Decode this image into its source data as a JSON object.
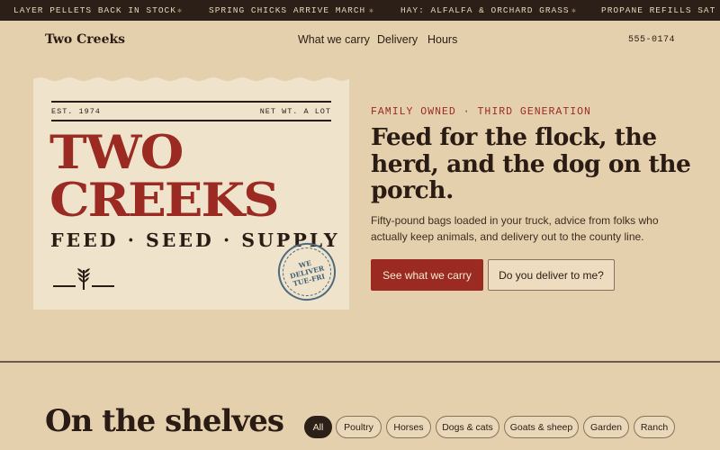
{
  "ticker": {
    "items": [
      "LAYER PELLETS BACK IN STOCK",
      "SPRING CHICKS ARRIVE MARCH",
      "HAY: ALFALFA & ORCHARD GRASS",
      "PROPANE REFILLS SAT MORN"
    ],
    "separator": "✱"
  },
  "nav": {
    "brand": "Two Creeks",
    "links": [
      "What we carry",
      "Delivery",
      "Hours"
    ],
    "phone": "555-0174"
  },
  "hero_card": {
    "established": "EST. 1974",
    "net_weight": "NET WT. A LOT",
    "word1": "TWO",
    "word2": "CREEKS",
    "subline": "FEED · SEED · SUPPLY",
    "stamp": "WE DELIVER TUE-FRI",
    "icon": "wheat-icon"
  },
  "hero": {
    "eyebrow": "FAMILY OWNED · THIRD GENERATION",
    "headline": "Feed for the flock, the herd, and the dog on the porch.",
    "lede": "Fifty-pound bags loaded in your truck, advice from folks who actually keep animals, and delivery out to the county line.",
    "primary_cta": "See what we carry",
    "secondary_cta": "Do you deliver to me?"
  },
  "shelves": {
    "title": "On the shelves",
    "filters": [
      "All",
      "Poultry",
      "Horses",
      "Dogs & cats",
      "Goats & sheep",
      "Garden",
      "Ranch"
    ],
    "active": "All"
  },
  "colors": {
    "background": "#e4d0ad",
    "ink": "#2a1c14",
    "accent_red": "#9a2a22",
    "stamp_blue": "#4d6b7e"
  }
}
